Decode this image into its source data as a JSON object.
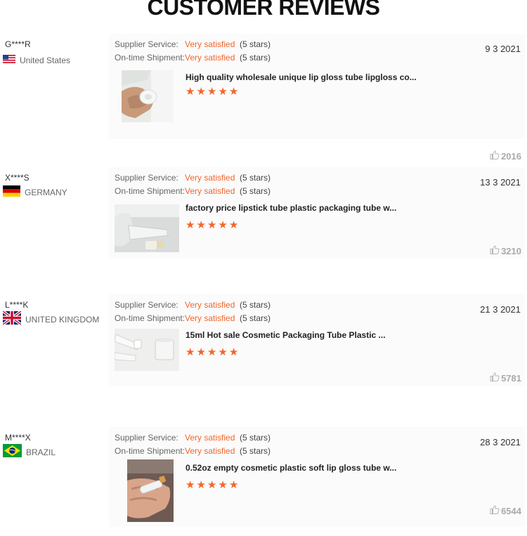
{
  "page_title": "CUSTOMER REVIEWS",
  "labels": {
    "supplier_service": "Supplier Service:",
    "ontime_shipment": "On-time Shipment:"
  },
  "colors": {
    "accent": "#f2662b"
  },
  "reviews": [
    {
      "user": "G****R",
      "country": "United States",
      "flag": "us-flag",
      "date": "9 3 2021",
      "supplier_value": "Very satisfied",
      "supplier_stars": "(5 stars)",
      "shipment_value": "Very satisfied",
      "shipment_stars": "(5 stars)",
      "product_title": "High quality wholesale unique lip gloss tube lipgloss co...",
      "rating": 5,
      "likes": "2016"
    },
    {
      "user": "X****S",
      "country": "GERMANY",
      "flag": "germany-flag",
      "date": "13 3 2021",
      "supplier_value": "Very satisfied",
      "supplier_stars": "(5 stars)",
      "shipment_value": "Very satisfied",
      "shipment_stars": "(5 stars)",
      "product_title": "factory price lipstick tube plastic packaging tube w...",
      "rating": 5,
      "likes": "3210"
    },
    {
      "user": "L****K",
      "country": "UNITED KINGDOM",
      "flag": "uk-flag",
      "date": "21 3 2021",
      "supplier_value": "Very satisfied",
      "supplier_stars": "(5 stars)",
      "shipment_value": "Very satisfied",
      "shipment_stars": "(5 stars)",
      "product_title": "15ml Hot sale Cosmetic Packaging Tube Plastic ...",
      "rating": 5,
      "likes": "5781"
    },
    {
      "user": "M****X",
      "country": "BRAZIL",
      "flag": "brazil-flag",
      "date": "28 3 2021",
      "supplier_value": "Very satisfied",
      "supplier_stars": "(5 stars)",
      "shipment_value": "Very satisfied",
      "shipment_stars": "(5 stars)",
      "product_title": "0.52oz empty cosmetic plastic soft lip gloss tube w...",
      "rating": 5,
      "likes": "6544"
    }
  ]
}
